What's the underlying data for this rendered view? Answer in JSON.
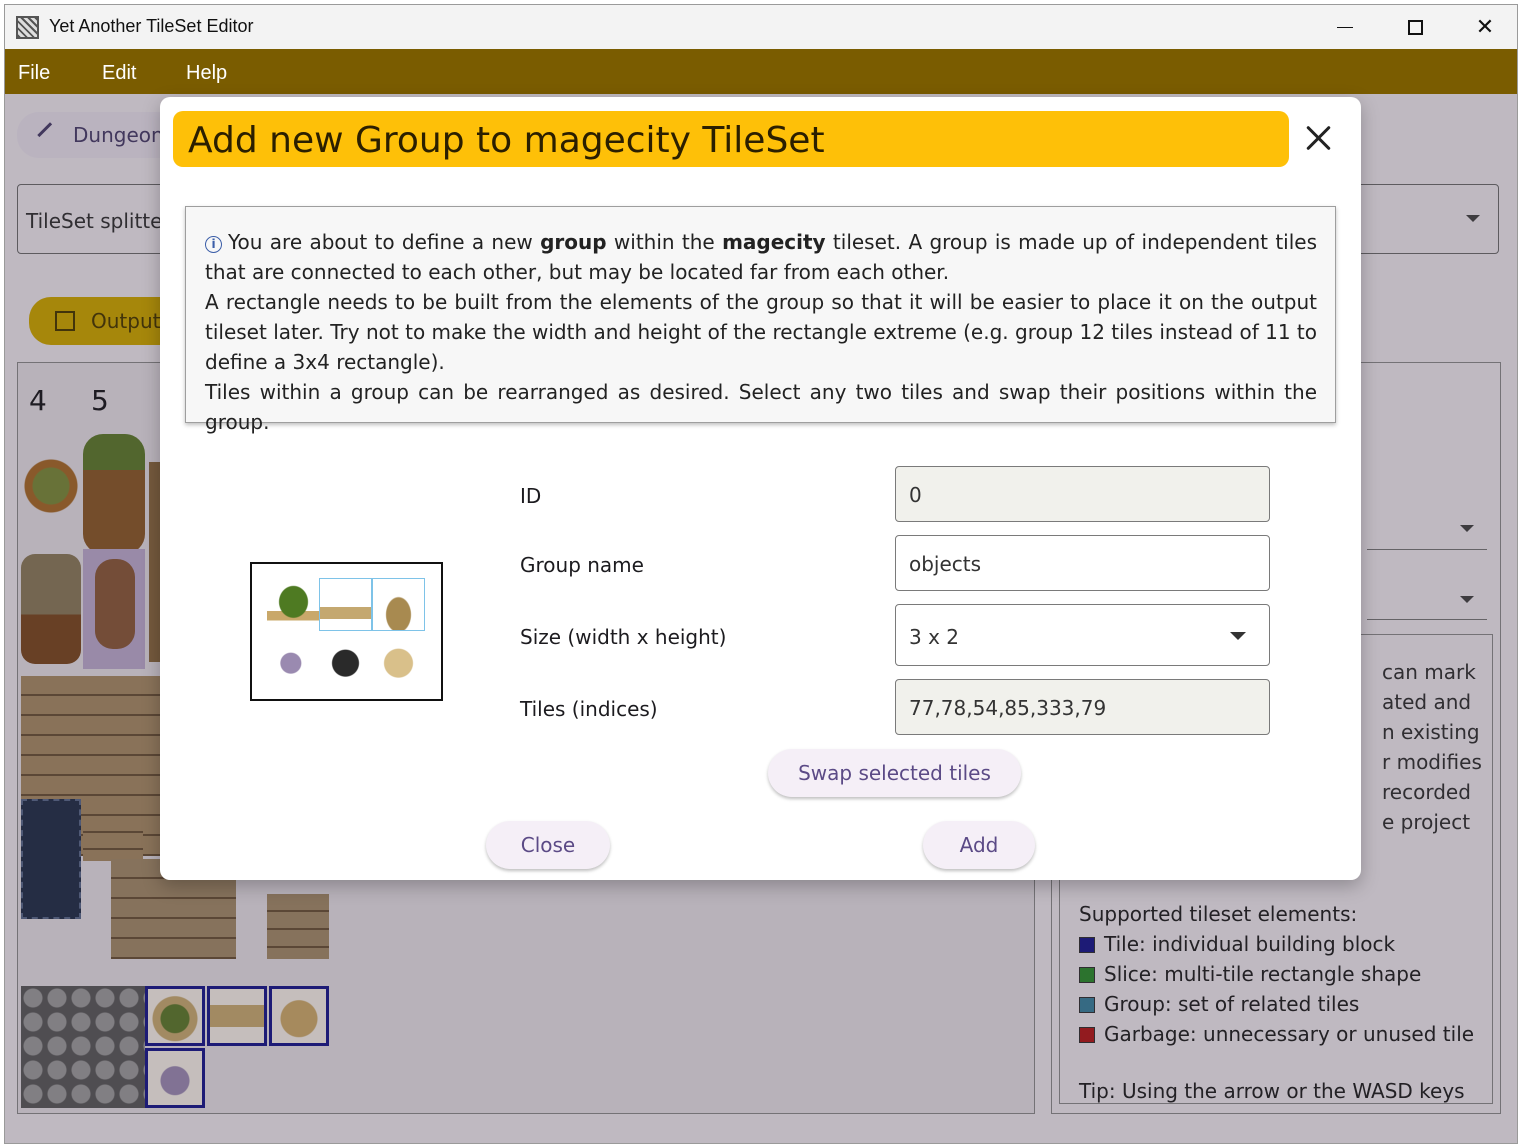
{
  "window": {
    "title": "Yet Another TileSet Editor"
  },
  "menu": [
    "File",
    "Edit",
    "Help"
  ],
  "background": {
    "project_tab": "Dungeon",
    "splitter_select": "TileSet splitter",
    "output_button": "Output",
    "column_numbers": [
      "4",
      "5"
    ],
    "right_fragments": [
      "can  mark",
      "ated  and",
      "n  existing",
      "r modifies",
      "recorded",
      "e    project"
    ],
    "legend_title": "Supported tileset elements:",
    "legend": [
      {
        "label": "Tile: individual building block",
        "color": "#1a1a8a"
      },
      {
        "label": "Slice: multi-tile rectangle shape",
        "color": "#2e8b2e"
      },
      {
        "label": "Group: set of related tiles",
        "color": "#3a7f9a"
      },
      {
        "label": "Garbage: unnecessary or unused tile",
        "color": "#b01a1a"
      }
    ],
    "tip": "Tip: Using the arrow or the WASD keys"
  },
  "dialog": {
    "title": "Add new Group to magecity TileSet",
    "info": {
      "p1_a": "You are about to define a new ",
      "p1_b": "group",
      "p1_c": " within the ",
      "p1_d": "magecity",
      "p1_e": " tileset. A group is made up of independent tiles that are connected to each other, but may be located far from each other.",
      "p2": "A rectangle needs to be built from the elements of the group so that it will be easier to place it on the output tileset later. Try not to make the width and height of the rectangle extreme (e.g. group 12 tiles instead of 11 to define a 3x4 rectangle).",
      "p3": "Tiles within a group can be rearranged as desired. Select any two tiles and swap their positions within the group."
    },
    "fields": {
      "id_label": "ID",
      "id_value": "0",
      "name_label": "Group name",
      "name_value": "objects",
      "size_label": "Size (width x height)",
      "size_value": "3 x 2",
      "tiles_label": "Tiles (indices)",
      "tiles_value": "77,78,54,85,333,79"
    },
    "swap_button": "Swap selected tiles",
    "close_button": "Close",
    "add_button": "Add"
  }
}
